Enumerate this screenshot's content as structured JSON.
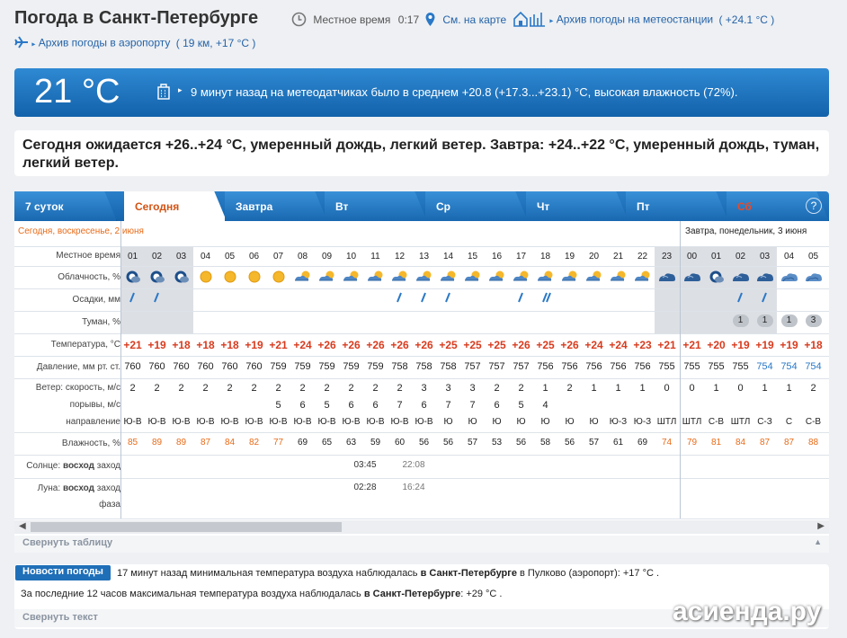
{
  "header": {
    "title": "Погода в Санкт-Петербурге",
    "local_time_label": "Местное время",
    "local_time_value": "0:17",
    "map_link": "См. на карте",
    "station_archive": "Архив погоды на метеостанции",
    "station_temp": "( +24.1 °C )",
    "airport_archive": "Архив погоды в аэропорту",
    "airport_info": "( 19 км, +17 °C )"
  },
  "current": {
    "temp": "21 °C",
    "message": "9 минут назад на метеодатчиках было в среднем +20.8 (+17.3...+23.1) °C, высокая влажность (72%)."
  },
  "forecast_text": "Сегодня ожидается +26..+24 °C, умеренный дождь, легкий ветер. Завтра: +24..+22 °C, умеренный дождь, туман, легкий ветер.",
  "tabs": [
    "7 суток",
    "Сегодня",
    "Завтра",
    "Вт",
    "Ср",
    "Чт",
    "Пт",
    "Сб"
  ],
  "help_icon": "?",
  "day_today": "Сегодня, воскресенье, 2 июня",
  "day_tomorrow": "Завтра, понедельник, 3 июня",
  "row_labels": {
    "time": "Местное время",
    "cloud": "Облачность, %",
    "precip": "Осадки, мм",
    "fog": "Туман, %",
    "temp": "Температура, °C",
    "pressure": "Давление, мм рт. ст.",
    "wind": "Ветер: скорость, м/с",
    "gust": "порывы, м/с",
    "dir": "направление",
    "humidity": "Влажность, %",
    "sun_prefix": "Солнце:",
    "sun_rise": "восход",
    "sun_set": "заход",
    "moon_prefix": "Луна:",
    "moon_rise": "восход",
    "moon_set": "заход",
    "phase": "фаза"
  },
  "hours": [
    "01",
    "02",
    "03",
    "04",
    "05",
    "06",
    "07",
    "08",
    "09",
    "10",
    "11",
    "12",
    "13",
    "14",
    "15",
    "16",
    "17",
    "18",
    "19",
    "20",
    "21",
    "22",
    "23",
    "00",
    "01",
    "02",
    "03",
    "04",
    "05"
  ],
  "cloud_icons": [
    "night-cloudy",
    "night-cloudy",
    "night-cloudy",
    "sun",
    "sun",
    "sun",
    "sun",
    "sun-cloud",
    "sun-cloud",
    "sun-cloud",
    "sun-cloud",
    "sun-cloud",
    "sun-cloud",
    "sun-cloud",
    "sun-cloud",
    "sun-cloud",
    "sun-cloud",
    "sun-cloud",
    "sun-cloud",
    "sun-cloud",
    "sun-cloud",
    "sun-cloud",
    "cloud-dark",
    "cloud-dark",
    "night-cloudy",
    "cloud-dark",
    "cloud-dark",
    "cloud-full",
    "cloud-full"
  ],
  "precip": [
    1,
    1,
    0,
    0,
    0,
    0,
    0,
    0,
    0,
    0,
    0,
    1,
    1,
    1,
    0,
    0,
    1,
    2,
    0,
    0,
    0,
    0,
    0,
    0,
    0,
    1,
    1,
    0,
    0
  ],
  "fog": [
    "",
    "",
    "",
    "",
    "",
    "",
    "",
    "",
    "",
    "",
    "",
    "",
    "",
    "",
    "",
    "",
    "",
    "",
    "",
    "",
    "",
    "",
    "",
    "",
    "",
    "1",
    "1",
    "1",
    "3"
  ],
  "temps": [
    "+21",
    "+19",
    "+18",
    "+18",
    "+18",
    "+19",
    "+21",
    "+24",
    "+26",
    "+26",
    "+26",
    "+26",
    "+26",
    "+25",
    "+25",
    "+25",
    "+26",
    "+25",
    "+26",
    "+24",
    "+24",
    "+23",
    "+21",
    "+21",
    "+20",
    "+19",
    "+19",
    "+19",
    "+18"
  ],
  "pressure": [
    "760",
    "760",
    "760",
    "760",
    "760",
    "760",
    "759",
    "759",
    "759",
    "759",
    "759",
    "758",
    "758",
    "758",
    "757",
    "757",
    "757",
    "756",
    "756",
    "756",
    "756",
    "756",
    "755",
    "755",
    "755",
    "755",
    "754",
    "754",
    "754"
  ],
  "wind": [
    "2",
    "2",
    "2",
    "2",
    "2",
    "2",
    "2",
    "2",
    "2",
    "2",
    "2",
    "2",
    "3",
    "3",
    "3",
    "2",
    "2",
    "1",
    "2",
    "1",
    "1",
    "1",
    "0",
    "0",
    "1",
    "0",
    "1",
    "1",
    "2"
  ],
  "gusts": [
    "",
    "",
    "",
    "",
    "",
    "",
    "5",
    "6",
    "5",
    "6",
    "6",
    "7",
    "6",
    "7",
    "7",
    "6",
    "5",
    "4",
    "",
    "",
    "",
    "",
    "",
    "",
    "",
    "",
    "",
    "",
    ""
  ],
  "dirs": [
    "Ю-В",
    "Ю-В",
    "Ю-В",
    "Ю-В",
    "Ю-В",
    "Ю-В",
    "Ю-В",
    "Ю-В",
    "Ю-В",
    "Ю-В",
    "Ю-В",
    "Ю-В",
    "Ю-В",
    "Ю",
    "Ю",
    "Ю",
    "Ю",
    "Ю",
    "Ю",
    "Ю",
    "Ю-З",
    "Ю-З",
    "ШТЛ",
    "ШТЛ",
    "С-В",
    "ШТЛ",
    "С-З",
    "С",
    "С-В"
  ],
  "humidity": [
    "85",
    "89",
    "89",
    "87",
    "84",
    "82",
    "77",
    "69",
    "65",
    "63",
    "59",
    "60",
    "56",
    "56",
    "57",
    "53",
    "56",
    "58",
    "56",
    "57",
    "61",
    "69",
    "74",
    "79",
    "81",
    "84",
    "87",
    "87",
    "88"
  ],
  "sun": {
    "rise": "03:45",
    "set": "22:08"
  },
  "moon": {
    "rise": "02:28",
    "set": "16:24"
  },
  "collapse_table": "Свернуть таблицу",
  "news": {
    "badge": "Новости погоды",
    "line1_a": "17 минут назад минимальная температура воздуха наблюдалась ",
    "line1_b": "в Санкт-Петербурге",
    "line1_c": " в Пулково (аэропорт): +17 °C .",
    "line2_a": "За последние 12 часов максимальная температура воздуха наблюдалась ",
    "line2_b": "в Санкт-Петербурге",
    "line2_c": ": +29 °C .",
    "collapse": "Свернуть текст"
  },
  "watermark": "асиенда.ру",
  "colors": {
    "accent": "#1a6db8",
    "warm": "#d83b1e",
    "humid": "#e86a17"
  }
}
